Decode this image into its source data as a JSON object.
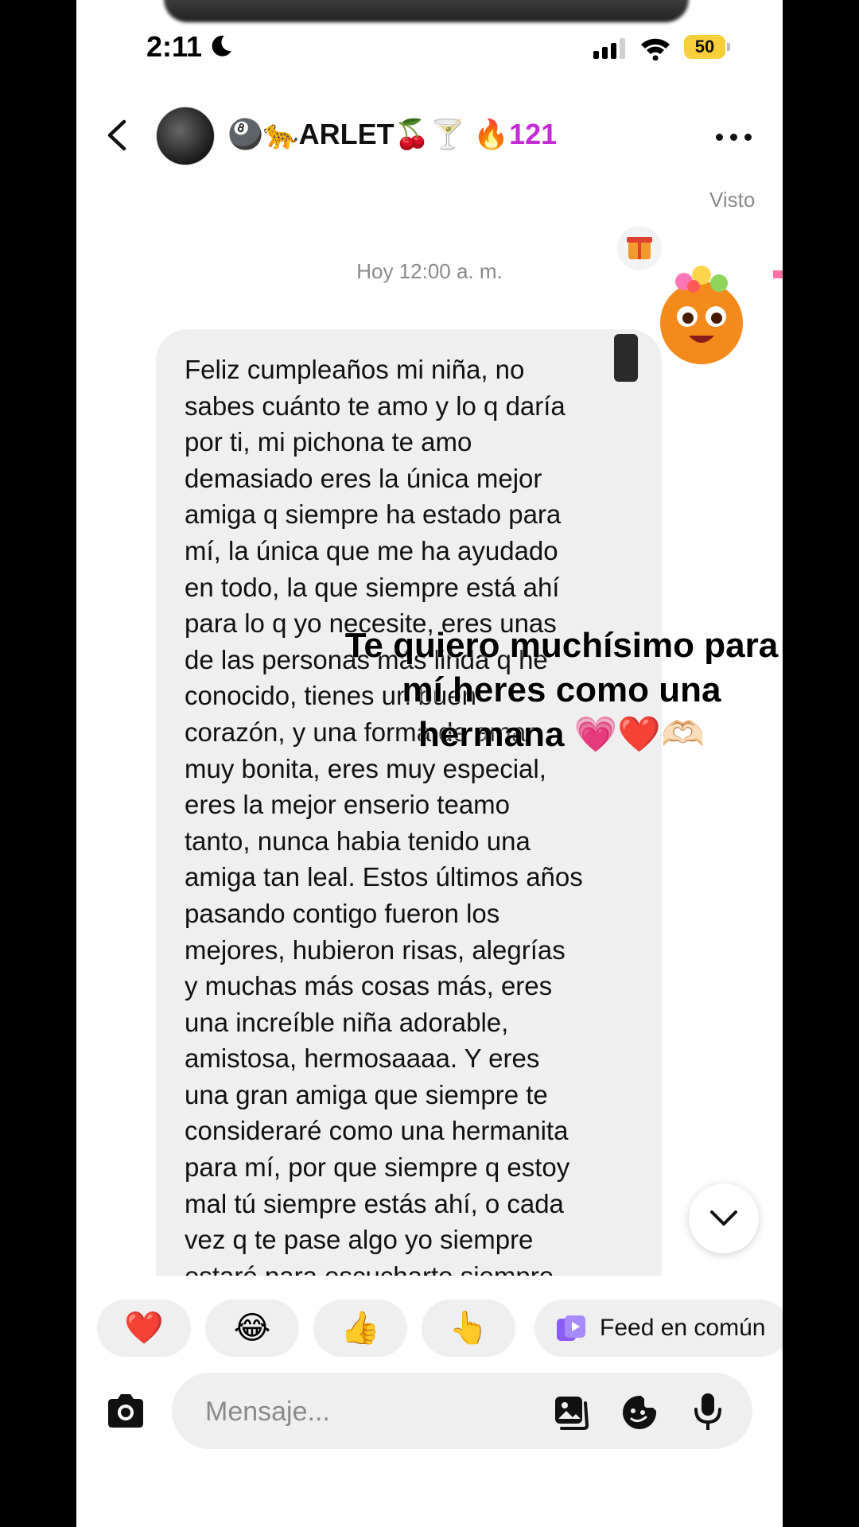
{
  "status_bar": {
    "time": "2:11",
    "battery": "50"
  },
  "header": {
    "contact_name": "🎱🐆ARLET🍒🍸",
    "streak": "🔥121"
  },
  "chat": {
    "seen_label": "Visto",
    "timestamp": "Hoy 12:00 a. m.",
    "message": "Feliz cumpleaños mi niña, no\nsabes cuánto te amo y lo q daría\npor ti, mi  pichona te amo\ndemasiado eres la única mejor\namiga q siempre ha estado para\nmí, la única que me ha ayudado\nen todo, la que siempre está ahí\npara lo q yo necesite, eres unas\nde las personas más linda q he\nconocido, tienes un buen\ncorazón, y una forma de amar\nmuy bonita, eres muy especial,\neres la mejor enserio teamo\ntanto, nunca habia tenido una\namiga tan leal. Estos últimos años\npasando contigo fueron los\nmejores, hubieron risas, alegrías\ny muchas más cosas más, eres\nuna increíble niña adorable,\namistosa, hermosaaaa. Y eres\nuna gran amiga que siempre te\nconsideraré como una hermanita\npara mí, por que siempre q estoy\nmal tú siempre estás ahí, o cada\nvez q te pase algo yo siempre\nestaré para escucharte siempre"
  },
  "overlay_caption": "Te quiero muchísimo para mí heres como una hermana 💗❤️🫶🏻",
  "quick_reactions": [
    "❤️",
    "😂",
    "👍",
    "👆"
  ],
  "feed_chip": {
    "label": "Feed en común",
    "icon": "shared-feed-icon"
  },
  "composer": {
    "placeholder": "Mensaje..."
  },
  "colors": {
    "streak": "#c42ad8",
    "battery": "#f7cf3a",
    "bubble": "#efefef",
    "muted": "#8a8a8a"
  }
}
